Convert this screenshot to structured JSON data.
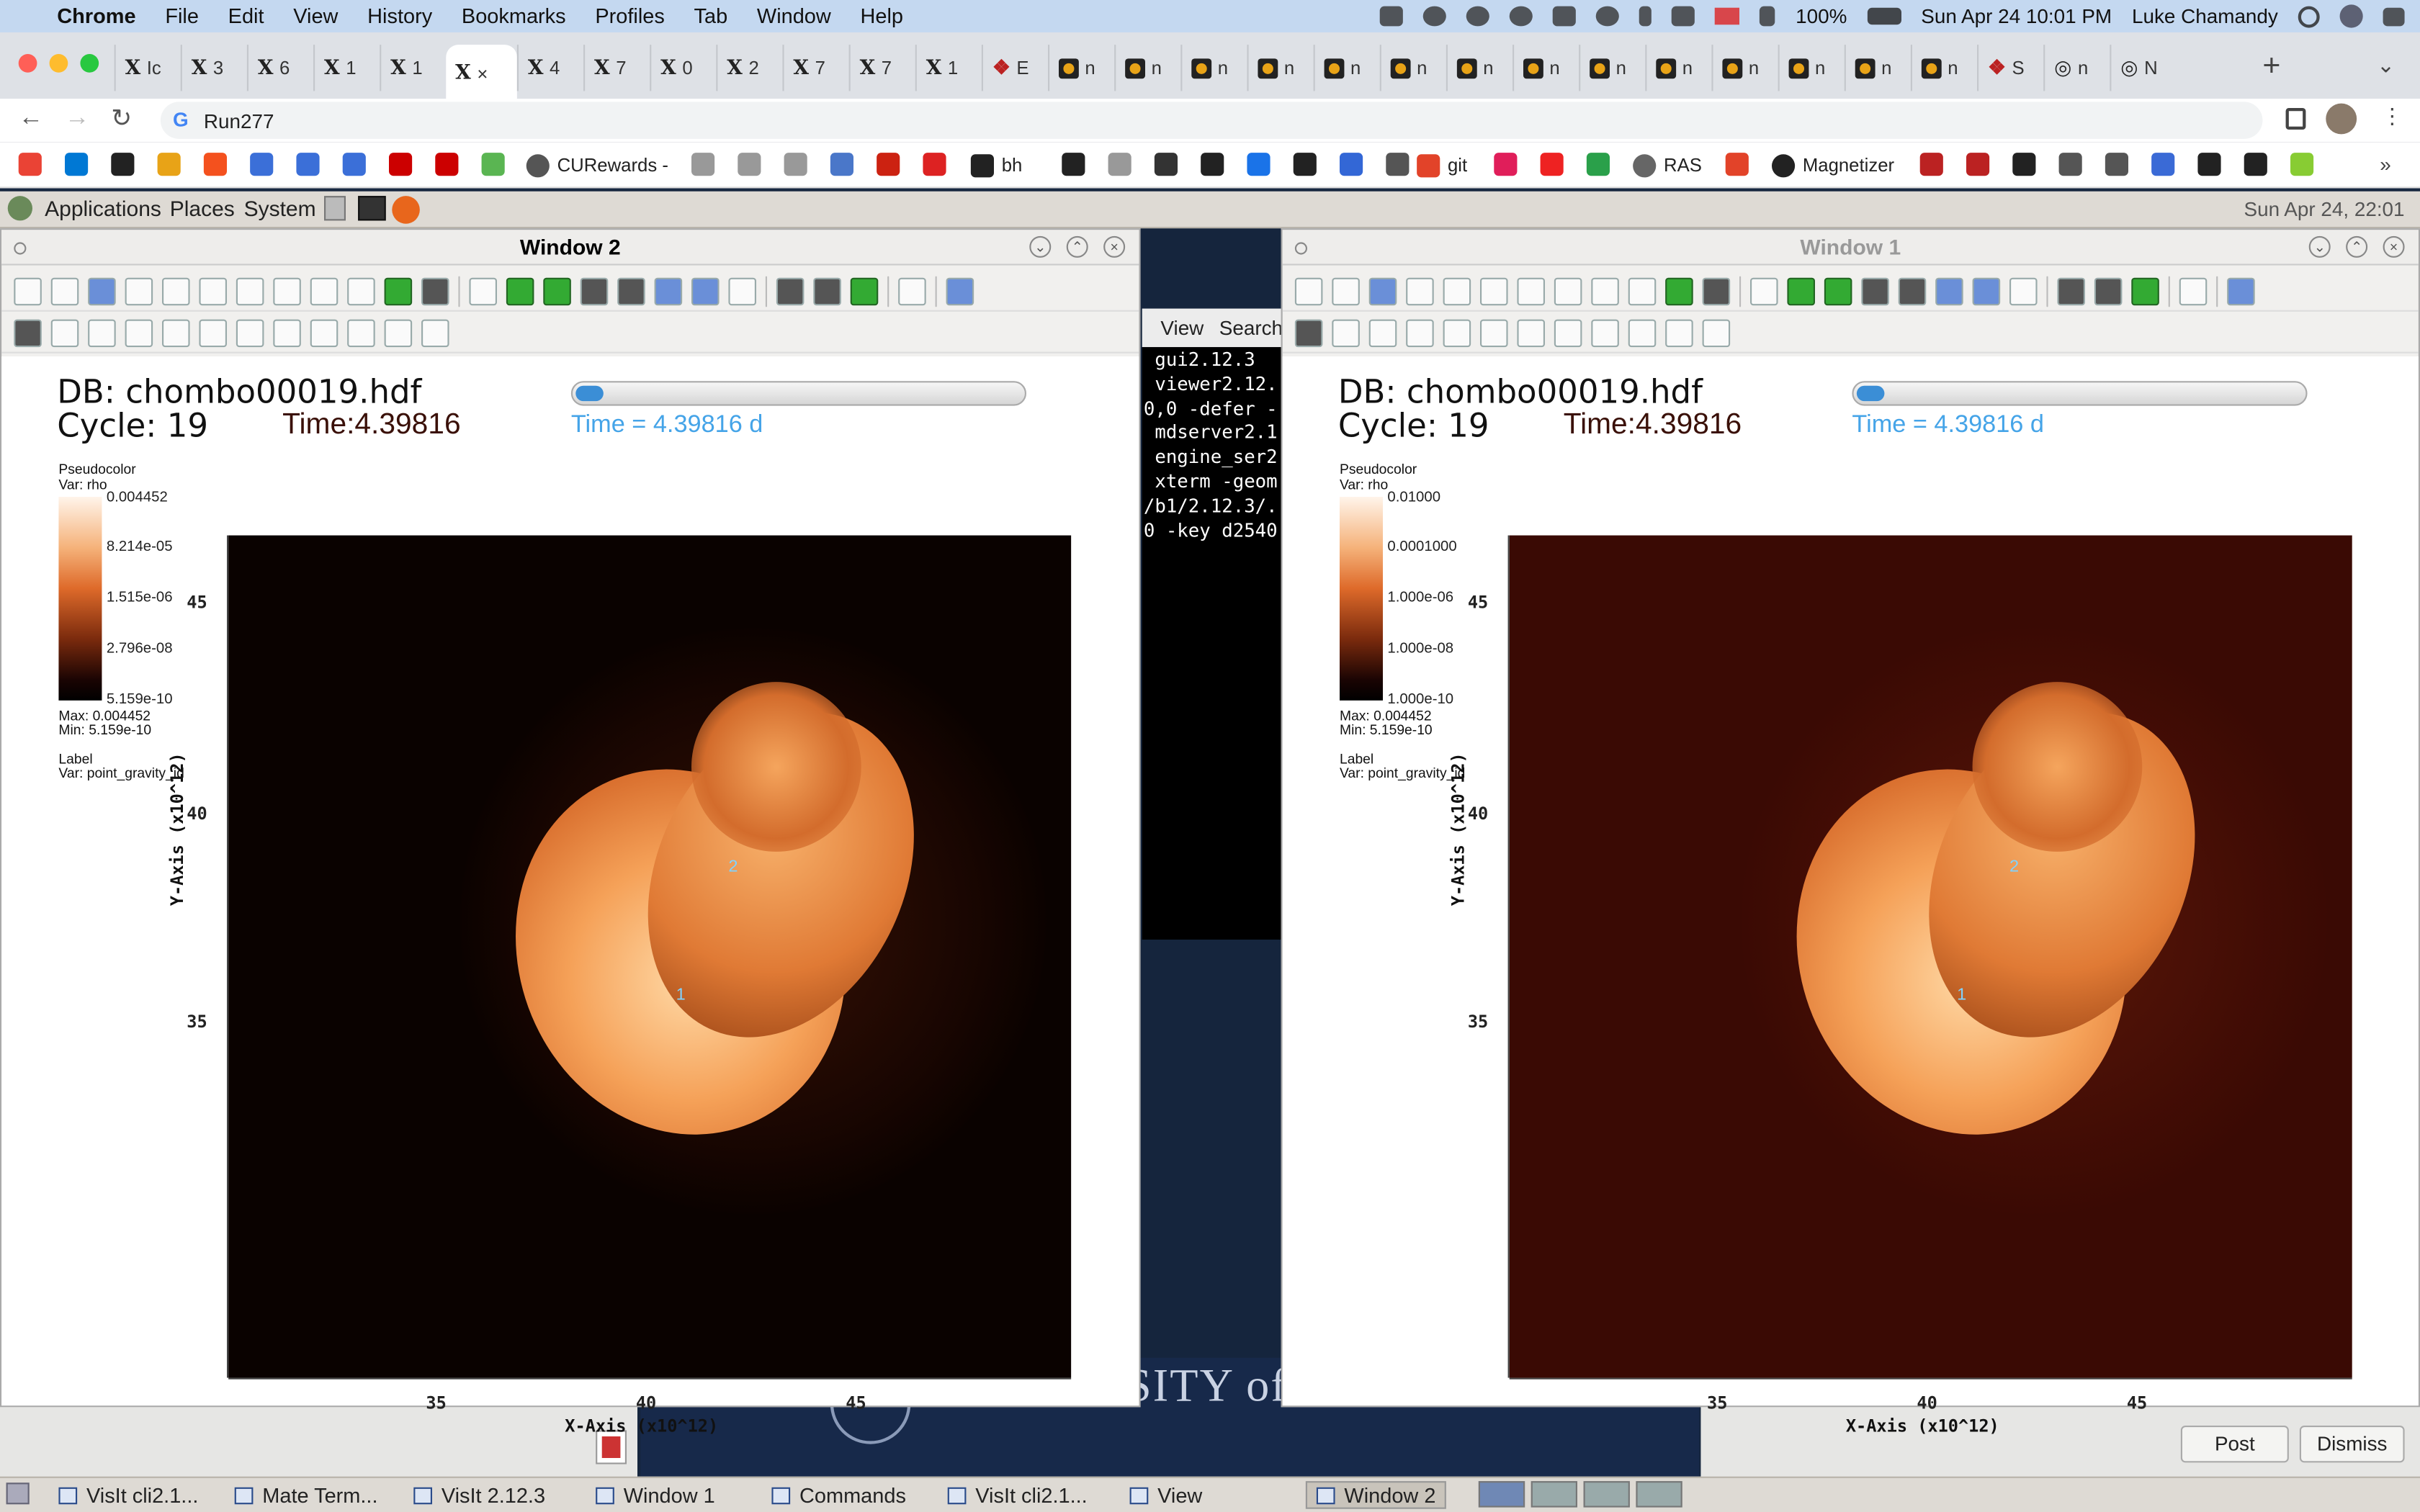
{
  "menubar": {
    "app": "Chrome",
    "items": [
      "File",
      "Edit",
      "View",
      "History",
      "Bookmarks",
      "Profiles",
      "Tab",
      "Window",
      "Help"
    ],
    "battery": "100%",
    "datetime": "Sun Apr 24  10:01 PM",
    "user": "Luke Chamandy"
  },
  "chrome": {
    "tabs": [
      "Ic",
      "3",
      "6",
      "1",
      "1",
      "×",
      "4",
      "7",
      "0",
      "2",
      "7",
      "7",
      "1",
      "E",
      "n",
      "n",
      "n",
      "n",
      "n",
      "n",
      "n",
      "n",
      "n",
      "n",
      "n",
      "n",
      "n",
      "n",
      "S",
      "n",
      "N"
    ],
    "address": "Run277",
    "bookmarks": [
      "CURewards -",
      "bh",
      "git",
      "RAS",
      "Magnetizer"
    ]
  },
  "mate": {
    "menus": [
      "Applications",
      "Places",
      "System"
    ],
    "clock": "Sun Apr 24, 22:01"
  },
  "windows": [
    {
      "title": "Window 2",
      "db": "DB: chombo00019.hdf",
      "cycle": "Cycle: 19",
      "time_ghost": "Time:4.39816",
      "time": "Time = 4.39816 d",
      "legend": {
        "type": "Pseudocolor",
        "var": "Var: rho",
        "ticks": [
          "0.004452",
          "8.214e-05",
          "1.515e-06",
          "2.796e-08",
          "5.159e-10"
        ],
        "max": "Max:  0.004452",
        "min": "Min:  5.159e-10",
        "label": "Label",
        "label_var": "Var: point_gravity_id"
      },
      "background_color": "#0a0200"
    },
    {
      "title": "Window 1",
      "db": "DB: chombo00019.hdf",
      "cycle": "Cycle: 19",
      "time_ghost": "Time:4.39816",
      "time": "Time = 4.39816 d",
      "legend": {
        "type": "Pseudocolor",
        "var": "Var: rho",
        "ticks": [
          "0.01000",
          "0.0001000",
          "1.000e-06",
          "1.000e-08",
          "1.000e-10"
        ],
        "max": "Max:  0.004452",
        "min": "Min:  5.159e-10",
        "label": "Label",
        "label_var": "Var: point_gravity_id"
      },
      "background_color": "#3a0a04"
    }
  ],
  "plot_axes": {
    "xlabel": "X-Axis (x10^12)",
    "ylabel": "Y-Axis (x10^12)",
    "xticks": [
      "35",
      "40",
      "45"
    ],
    "yticks": [
      "45",
      "40",
      "35"
    ],
    "point_labels": [
      "1",
      "2"
    ]
  },
  "terminal": {
    "menu": [
      "View",
      "Search"
    ],
    "lines": [
      " gui2.12.3",
      " viewer2.12.",
      "0,0 -defer -",
      " mdserver2.1",
      " engine_ser2",
      " xterm -geom",
      "/b1/2.12.3/.",
      "0 -key d2540"
    ]
  },
  "messages": {
    "post": "Post",
    "dismiss": "Dismiss",
    "bg_text": "UNIVERSITY of ROCHESTER"
  },
  "taskbar": [
    "VisIt cli2.1...",
    "Mate Term...",
    "VisIt 2.12.3",
    "Window 1",
    "Commands",
    "VisIt cli2.1...",
    "View",
    "Window 2"
  ]
}
